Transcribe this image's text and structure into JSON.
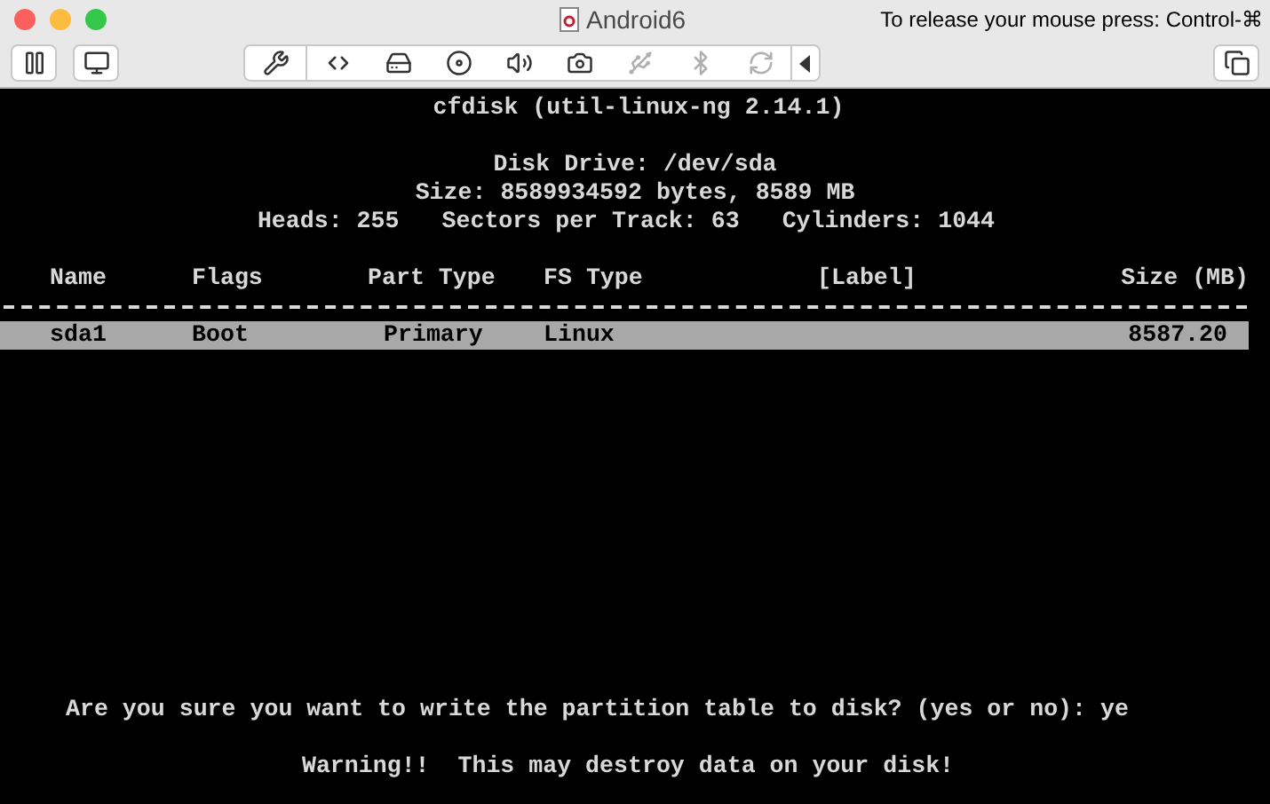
{
  "window": {
    "title": "Android6",
    "hint": "To release your mouse press: Control-⌘"
  },
  "toolbar": {
    "left": [
      {
        "kind": "pause"
      },
      {
        "kind": "snapshot"
      }
    ],
    "devices": [
      {
        "kind": "settings",
        "disabled": false
      },
      {
        "kind": "network",
        "disabled": false
      },
      {
        "kind": "disk",
        "disabled": false
      },
      {
        "kind": "optical",
        "disabled": false
      },
      {
        "kind": "audio",
        "disabled": false
      },
      {
        "kind": "camera",
        "disabled": false
      },
      {
        "kind": "usb",
        "disabled": true
      },
      {
        "kind": "bluetooth",
        "disabled": true
      },
      {
        "kind": "sharing",
        "disabled": true
      },
      {
        "kind": "collapse",
        "disabled": false
      }
    ],
    "right": [
      {
        "kind": "windows"
      }
    ]
  },
  "terminal": {
    "title": "cfdisk (util-linux-ng 2.14.1)",
    "info": [
      "Disk Drive: /dev/sda",
      "Size: 8589934592 bytes, 8589 MB"
    ],
    "geometry": [
      "Heads: 255",
      "Sectors per Track: 63",
      "Cylinders: 1044"
    ],
    "columns": [
      "Name",
      "Flags",
      "Part Type",
      "FS Type",
      "[Label]",
      "Size (MB)"
    ],
    "rows": [
      {
        "selected": true,
        "cells": [
          "sda1",
          "Boot",
          "Primary",
          "Linux",
          "",
          "8587.20"
        ]
      }
    ],
    "prompt": "Are you sure you want to write the partition table to disk? (yes or no): ye",
    "warning": "Warning!!  This may destroy data on your disk!"
  }
}
